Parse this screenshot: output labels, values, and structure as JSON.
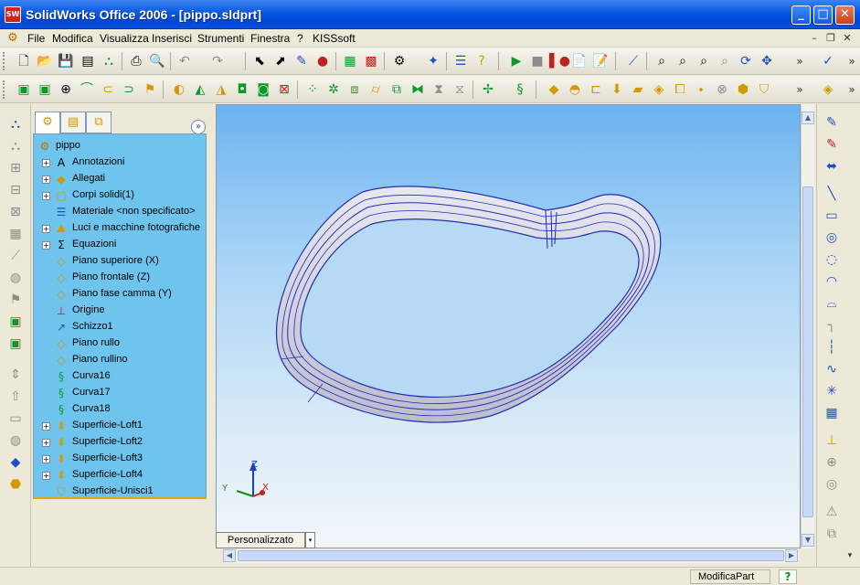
{
  "window": {
    "title": "SolidWorks Office 2006 - [pippo.sldprt]",
    "app_icon_label": "SW",
    "controls": {
      "minimize": "_",
      "maximize": "□",
      "close": "✕"
    }
  },
  "menubar": {
    "items": [
      "File",
      "Modifica",
      "Visualizza",
      "Inserisci",
      "Strumenti",
      "Finestra",
      "?",
      "KISSsoft"
    ],
    "doc_controls": [
      "–",
      "❐",
      "✕"
    ]
  },
  "featuremanager": {
    "tabs": [
      "tree-icon",
      "properties-icon",
      "configuration-icon"
    ],
    "collapse_label": "»",
    "tree": [
      {
        "label": "pippo",
        "icon": "part-icon",
        "expandable": false,
        "root": true
      },
      {
        "label": "Annotazioni",
        "icon": "annotation-icon",
        "expandable": true
      },
      {
        "label": "Allegati",
        "icon": "attachment-icon",
        "expandable": true
      },
      {
        "label": "Corpi solidi(1)",
        "icon": "folder-icon",
        "expandable": true
      },
      {
        "label": "Materiale <non specificato>",
        "icon": "material-icon",
        "expandable": false
      },
      {
        "label": "Luci e macchine fotografiche",
        "icon": "lights-icon",
        "expandable": true
      },
      {
        "label": "Equazioni",
        "icon": "equation-icon",
        "expandable": true
      },
      {
        "label": "Piano superiore (X)",
        "icon": "plane-icon",
        "expandable": false
      },
      {
        "label": "Piano frontale (Z)",
        "icon": "plane-icon",
        "expandable": false
      },
      {
        "label": "Piano fase camma (Y)",
        "icon": "plane-icon",
        "expandable": false
      },
      {
        "label": "Origine",
        "icon": "origin-icon",
        "expandable": false
      },
      {
        "label": "Schizzo1",
        "icon": "sketch-icon",
        "expandable": false
      },
      {
        "label": "Piano rullo",
        "icon": "plane-icon",
        "expandable": false
      },
      {
        "label": "Piano rullino",
        "icon": "plane-icon",
        "expandable": false
      },
      {
        "label": "Curva16",
        "icon": "curve-icon",
        "expandable": false
      },
      {
        "label": "Curva17",
        "icon": "curve-icon",
        "expandable": false
      },
      {
        "label": "Curva18",
        "icon": "curve-icon",
        "expandable": false
      },
      {
        "label": "Superficie-Loft1",
        "icon": "loft-icon",
        "expandable": true
      },
      {
        "label": "Superficie-Loft2",
        "icon": "loft-icon",
        "expandable": true
      },
      {
        "label": "Superficie-Loft3",
        "icon": "loft-icon",
        "expandable": true
      },
      {
        "label": "Superficie-Loft4",
        "icon": "loft-icon",
        "expandable": true
      },
      {
        "label": "Superficie-Unisci1",
        "icon": "knit-icon",
        "expandable": false
      }
    ]
  },
  "viewport": {
    "triad": {
      "x": "X",
      "y": "Y",
      "z": "Z"
    },
    "tab_label": "Personalizzato",
    "tab_arrow": "▾"
  },
  "statusbar": {
    "text": "ModificaPart",
    "help": "?"
  },
  "colors": {
    "viewport_top": "#6bb3f0",
    "viewport_bottom": "#f2f6fa",
    "tree_bg": "#6ec4ec",
    "edge": "#1f2fb0",
    "title_bar": "#0a58e0"
  }
}
